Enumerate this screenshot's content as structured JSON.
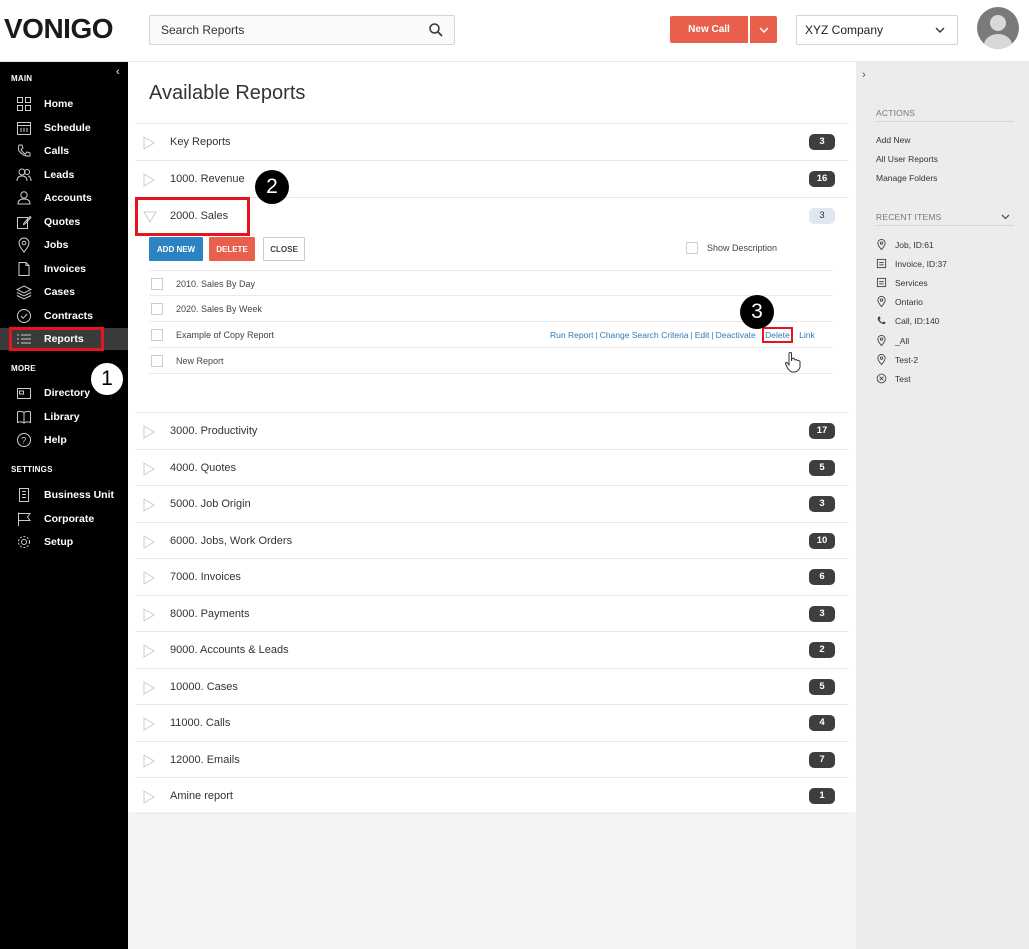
{
  "header": {
    "logo": "VONIGO",
    "search_placeholder": "Search Reports",
    "new_call": "New Call",
    "company": "XYZ Company"
  },
  "sidebar": {
    "sections": {
      "main": "MAIN",
      "more": "MORE",
      "settings": "SETTINGS"
    },
    "main_items": [
      {
        "label": "Home",
        "icon": "home-grid-icon"
      },
      {
        "label": "Schedule",
        "icon": "calendar-icon"
      },
      {
        "label": "Calls",
        "icon": "phone-icon"
      },
      {
        "label": "Leads",
        "icon": "leads-icon"
      },
      {
        "label": "Accounts",
        "icon": "user-icon"
      },
      {
        "label": "Quotes",
        "icon": "edit-icon"
      },
      {
        "label": "Jobs",
        "icon": "location-pin-icon"
      },
      {
        "label": "Invoices",
        "icon": "document-icon"
      },
      {
        "label": "Cases",
        "icon": "layers-icon"
      },
      {
        "label": "Contracts",
        "icon": "check-circle-icon"
      },
      {
        "label": "Reports",
        "icon": "list-icon"
      }
    ],
    "more_items": [
      {
        "label": "Directory",
        "icon": "id-card-icon"
      },
      {
        "label": "Library",
        "icon": "book-icon"
      },
      {
        "label": "Help",
        "icon": "help-icon"
      }
    ],
    "settings_items": [
      {
        "label": "Business Unit",
        "icon": "building-icon"
      },
      {
        "label": "Corporate",
        "icon": "flag-icon"
      },
      {
        "label": "Setup",
        "icon": "cog-icon"
      }
    ],
    "active": "Reports"
  },
  "main": {
    "title": "Available Reports",
    "categories_top": [
      {
        "name": "Key Reports",
        "count": "3"
      },
      {
        "name": "1000. Revenue",
        "count": "16"
      },
      {
        "name": "2000. Sales",
        "count": "3"
      }
    ],
    "expanded": {
      "buttons": {
        "add": "ADD NEW",
        "delete": "DELETE",
        "close": "CLOSE"
      },
      "show_description": "Show Description",
      "reports": [
        "2010. Sales By Day",
        "2020. Sales By Week",
        "Example of Copy Report",
        "New Report"
      ],
      "row_actions": [
        "Run Report",
        "Change Search Criteria",
        "Edit",
        "Deactivate",
        "Delete",
        "Link"
      ]
    },
    "categories_bottom": [
      {
        "name": "3000. Productivity",
        "count": "17"
      },
      {
        "name": "4000. Quotes",
        "count": "5"
      },
      {
        "name": "5000. Job Origin",
        "count": "3"
      },
      {
        "name": "6000. Jobs, Work Orders",
        "count": "10"
      },
      {
        "name": "7000. Invoices",
        "count": "6"
      },
      {
        "name": "8000. Payments",
        "count": "3"
      },
      {
        "name": "9000. Accounts & Leads",
        "count": "2"
      },
      {
        "name": "10000. Cases",
        "count": "5"
      },
      {
        "name": "11000. Calls",
        "count": "4"
      },
      {
        "name": "12000. Emails",
        "count": "7"
      },
      {
        "name": "Amine report",
        "count": "1"
      }
    ]
  },
  "right_panel": {
    "actions_title": "ACTIONS",
    "actions": [
      "Add New",
      "All User Reports",
      "Manage Folders"
    ],
    "recent_title": "RECENT ITEMS",
    "recent": [
      {
        "label": "Job, ID:61",
        "icon": "location-pin-icon"
      },
      {
        "label": "Invoice, ID:37",
        "icon": "document-icon"
      },
      {
        "label": "Services",
        "icon": "document-icon"
      },
      {
        "label": "Ontario",
        "icon": "location-pin-icon"
      },
      {
        "label": "Call, ID:140",
        "icon": "phone-icon"
      },
      {
        "label": "_All",
        "icon": "location-pin-icon"
      },
      {
        "label": "Test-2",
        "icon": "location-pin-icon"
      },
      {
        "label": "Test",
        "icon": "close-circle-icon"
      }
    ]
  },
  "annotations": [
    "1",
    "2",
    "3"
  ],
  "colors": {
    "accent_red": "#e8604c",
    "accent_blue": "#2c83c2",
    "highlight": "#e5141f"
  }
}
